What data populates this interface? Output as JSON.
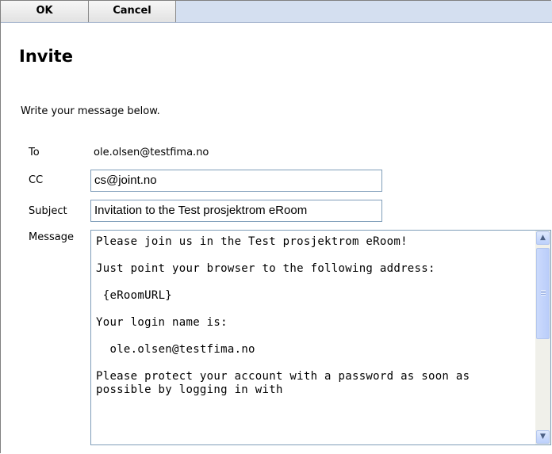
{
  "toolbar": {
    "ok_label": "OK",
    "cancel_label": "Cancel"
  },
  "page": {
    "title": "Invite",
    "intro": "Write your message below."
  },
  "form": {
    "to": {
      "label": "To",
      "value": "ole.olsen@testfima.no"
    },
    "cc": {
      "label": "CC",
      "value": "cs@joint.no"
    },
    "subject": {
      "label": "Subject",
      "value": "Invitation to the Test prosjektrom eRoom"
    },
    "message": {
      "label": "Message",
      "value": "Please join us in the Test prosjektrom eRoom!\n\nJust point your browser to the following address:\n\n {eRoomURL}\n\nYour login name is:\n\n  ole.olsen@testfima.no\n\nPlease protect your account with a password as soon as possible by logging in with"
    }
  },
  "icons": {
    "scroll_up": "chevron-up-icon",
    "scroll_down": "chevron-down-icon"
  },
  "colors": {
    "toolbar_bg": "#d4dff0",
    "input_border": "#7f9db9"
  }
}
